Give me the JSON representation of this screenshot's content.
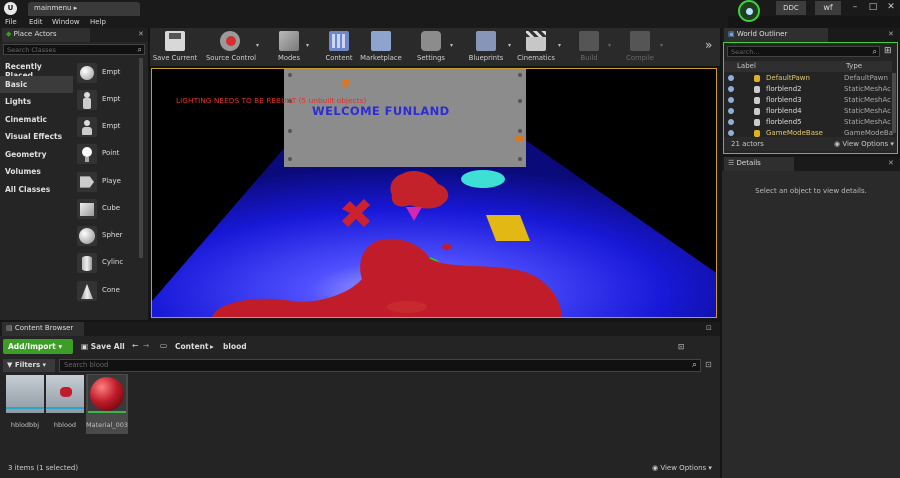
{
  "titlebar": {
    "logo": "U",
    "doc_tab": "mainmenu",
    "ddc_label": "DDC",
    "user_label": "wf",
    "win_min": "–",
    "win_max": "□",
    "win_close": "✕"
  },
  "menu": {
    "items": [
      "File",
      "Edit",
      "Window",
      "Help"
    ]
  },
  "place_actors": {
    "tab_label": "Place Actors",
    "search_placeholder": "Search Classes",
    "categories": [
      "Recently Placed",
      "Basic",
      "Lights",
      "Cinematic",
      "Visual Effects",
      "Geometry",
      "Volumes",
      "All Classes"
    ],
    "selected_category": "Basic",
    "actors": [
      "Empt",
      "Empt",
      "Empt",
      "Point",
      "Playe",
      "Cube",
      "Spher",
      "Cylinc",
      "Cone"
    ]
  },
  "toolbar": {
    "buttons": [
      {
        "label": "Save Current",
        "icon": "save-icon"
      },
      {
        "label": "Source Control",
        "icon": "source-control-icon"
      },
      {
        "label": "Modes",
        "icon": "modes-icon"
      },
      {
        "label": "Content",
        "icon": "content-icon"
      },
      {
        "label": "Marketplace",
        "icon": "marketplace-icon"
      },
      {
        "label": "Settings",
        "icon": "settings-icon"
      },
      {
        "label": "Blueprints",
        "icon": "blueprints-icon"
      },
      {
        "label": "Cinematics",
        "icon": "cinematics-icon"
      },
      {
        "label": "Build",
        "icon": "build-icon"
      },
      {
        "label": "Compile",
        "icon": "compile-icon"
      }
    ],
    "overflow": "»"
  },
  "viewport": {
    "lighting_warning": "LIGHTING NEEDS TO BE REBUILT (5 unbuilt objects)",
    "sign_text": "WELCOME FUNLAND"
  },
  "world_outliner": {
    "tab_label": "World Outliner",
    "search_placeholder": "Search...",
    "col_label": "Label",
    "col_type": "Type",
    "rows": [
      {
        "label": "DefaultPawn",
        "type": "DefaultPawn"
      },
      {
        "label": "florblend2",
        "type": "StaticMeshAc"
      },
      {
        "label": "florblend3",
        "type": "StaticMeshAc"
      },
      {
        "label": "florblend4",
        "type": "StaticMeshAc"
      },
      {
        "label": "florblend5",
        "type": "StaticMeshAc"
      },
      {
        "label": "GameModeBase",
        "type": "GameModeBa"
      }
    ],
    "actor_count": "21 actors",
    "view_options": "View Options"
  },
  "details": {
    "tab_label": "Details",
    "empty_message": "Select an object to view details."
  },
  "content_browser": {
    "tab_label": "Content Browser",
    "add_import": "Add/Import",
    "save_all": "Save All",
    "path": [
      "Content",
      "blood"
    ],
    "filters": "Filters",
    "search_placeholder": "Search blood",
    "assets": [
      {
        "name": "hblodbbj"
      },
      {
        "name": "hblood"
      },
      {
        "name": "Material_003"
      }
    ],
    "status": "3 items (1 selected)",
    "view_options": "View Options"
  }
}
